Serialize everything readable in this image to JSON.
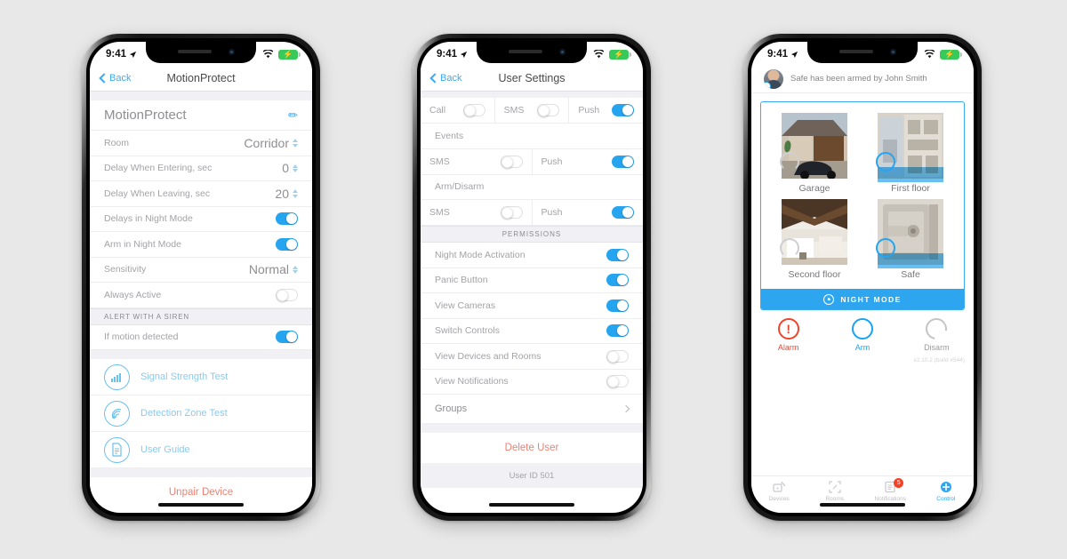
{
  "status_bar": {
    "time": "9:41",
    "location_icon": "location-arrow-icon",
    "wifi_icon": "wifi-icon",
    "battery_icon": "battery-charging-icon"
  },
  "phone1": {
    "nav": {
      "back_label": "Back",
      "title": "MotionProtect",
      "back_icon": "chevron-left-icon"
    },
    "device_name": "MotionProtect",
    "edit_icon": "pencil-icon",
    "settings_rows": [
      {
        "label": "Room",
        "value": "Corridor",
        "control": "stepper"
      },
      {
        "label": "Delay When Entering, sec",
        "value": "0",
        "control": "stepper"
      },
      {
        "label": "Delay When Leaving, sec",
        "value": "20",
        "control": "stepper"
      },
      {
        "label": "Delays in Night Mode",
        "value": "",
        "control": "toggle",
        "on": true
      },
      {
        "label": "Arm in Night Mode",
        "value": "",
        "control": "toggle",
        "on": true
      },
      {
        "label": "Sensitivity",
        "value": "Normal",
        "control": "stepper"
      },
      {
        "label": "Always Active",
        "value": "",
        "control": "toggle",
        "on": false
      }
    ],
    "siren_header": "ALERT WITH A SIREN",
    "siren_rows": [
      {
        "label": "If motion detected",
        "control": "toggle",
        "on": true
      }
    ],
    "actions": [
      {
        "label": "Signal Strength Test",
        "icon": "signal-bars-icon"
      },
      {
        "label": "Detection Zone Test",
        "icon": "motion-waves-icon"
      },
      {
        "label": "User Guide",
        "icon": "document-icon"
      }
    ],
    "unpair_label": "Unpair Device"
  },
  "phone2": {
    "nav": {
      "back_label": "Back",
      "title": "User Settings",
      "back_icon": "chevron-left-icon"
    },
    "alarm_row": [
      {
        "label": "Call",
        "on": false
      },
      {
        "label": "SMS",
        "on": false
      },
      {
        "label": "Push",
        "on": true
      }
    ],
    "events_label": "Events",
    "events_row": [
      {
        "label": "SMS",
        "on": false
      },
      {
        "label": "Push",
        "on": true
      }
    ],
    "armdisarm_label": "Arm/Disarm",
    "armdisarm_row": [
      {
        "label": "SMS",
        "on": false
      },
      {
        "label": "Push",
        "on": true
      }
    ],
    "permissions_header": "PERMISSIONS",
    "permissions": [
      {
        "label": "Night Mode Activation",
        "on": true
      },
      {
        "label": "Panic Button",
        "on": true
      },
      {
        "label": "View Cameras",
        "on": true
      },
      {
        "label": "Switch Controls",
        "on": true
      },
      {
        "label": "View Devices and Rooms",
        "on": false
      },
      {
        "label": "View Notifications",
        "on": false
      }
    ],
    "groups_label": "Groups",
    "groups_icon": "chevron-right-icon",
    "delete_label": "Delete User",
    "user_id": "User ID 501"
  },
  "phone3": {
    "notification": "Safe has been armed by John Smith",
    "avatar_icon": "user-avatar",
    "rooms": [
      {
        "name": "Garage",
        "armed": false,
        "photo": "garage-photo"
      },
      {
        "name": "First floor",
        "armed": true,
        "photo": "first-floor-photo"
      },
      {
        "name": "Second floor",
        "armed": false,
        "photo": "second-floor-photo"
      },
      {
        "name": "Safe",
        "armed": true,
        "photo": "safe-photo"
      }
    ],
    "night_mode_label": "NIGHT MODE",
    "night_mode_icon": "moon-icon",
    "modes": [
      {
        "label": "Alarm",
        "icon": "alarm-exclamation-icon",
        "color": "#f1432a"
      },
      {
        "label": "Arm",
        "icon": "arm-circle-icon",
        "color": "#17a3f5"
      },
      {
        "label": "Disarm",
        "icon": "disarm-arc-icon",
        "color": "#9a9a9f"
      }
    ],
    "version": "v2.10.2 (build #544)",
    "tabs": [
      {
        "label": "Devices",
        "icon": "device-icon",
        "active": false,
        "badge": ""
      },
      {
        "label": "Rooms",
        "icon": "rooms-icon",
        "active": false,
        "badge": ""
      },
      {
        "label": "Notifications",
        "icon": "notifications-icon",
        "active": false,
        "badge": "5"
      },
      {
        "label": "Control",
        "icon": "control-plus-icon",
        "active": true,
        "badge": ""
      }
    ]
  },
  "colors": {
    "accent": "#2ea6ef",
    "danger": "#f1432a",
    "destructive": "#ee8072",
    "muted": "#a3a3a8"
  }
}
